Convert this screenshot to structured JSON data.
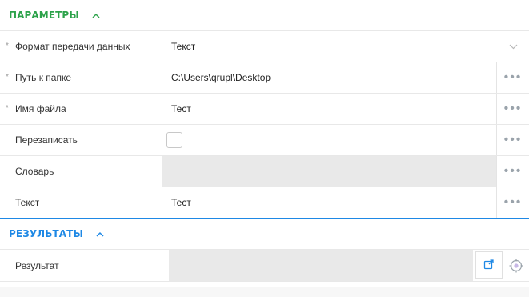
{
  "params": {
    "title": "ПАРАМЕТРЫ",
    "rows": [
      {
        "label": "Формат передачи данных",
        "value": "Текст",
        "required": "*"
      },
      {
        "label": "Путь к папке",
        "value": "C:\\Users\\qrupl\\Desktop",
        "required": "*"
      },
      {
        "label": "Имя файла",
        "value": "Тест",
        "required": "*"
      },
      {
        "label": "Перезаписать",
        "value": ""
      },
      {
        "label": "Словарь",
        "value": ""
      },
      {
        "label": "Текст",
        "value": "Тест"
      }
    ],
    "dots": "•••"
  },
  "results": {
    "title": "РЕЗУЛЬТАТЫ",
    "rows": [
      {
        "label": "Результат",
        "value": ""
      }
    ]
  },
  "colors": {
    "params_accent": "#2ca24a",
    "results_accent": "#1e88e5",
    "field_disabled": "#e9e9e9"
  },
  "icons": [
    "chevron-up-icon",
    "chevron-down-icon",
    "more-dots-icon",
    "export-icon",
    "target-icon"
  ]
}
